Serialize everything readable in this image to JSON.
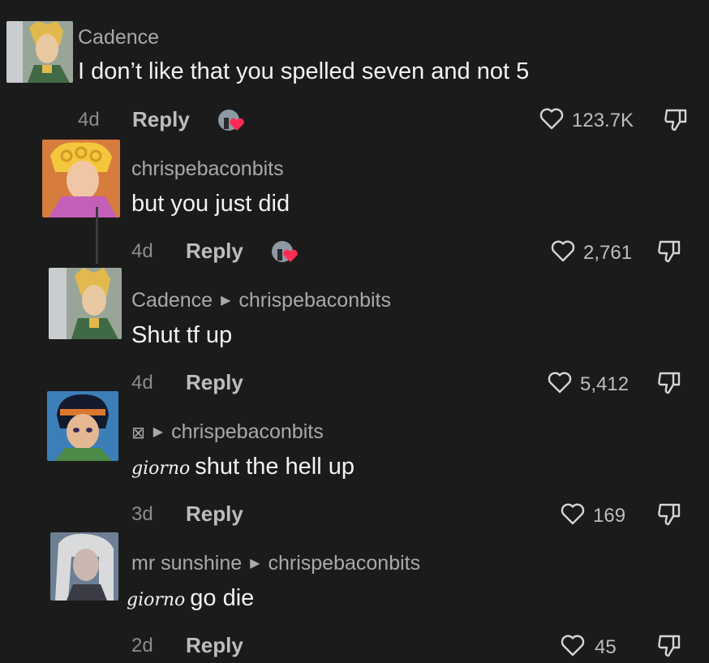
{
  "comments": [
    {
      "username": "Cadence",
      "reply_to": "",
      "text": "I don’t like that you spelled seven and not 5",
      "handwritten_prefix": "",
      "age": "4d",
      "reply_label": "Reply",
      "likes": "123.7K",
      "creator_liked": true
    },
    {
      "username": "chrispebaconbits",
      "reply_to": "",
      "text": "but you just did",
      "handwritten_prefix": "",
      "age": "4d",
      "reply_label": "Reply",
      "likes": "2,761",
      "creator_liked": true
    },
    {
      "username": "Cadence",
      "reply_to": "chrispebaconbits",
      "text": "Shut tf up",
      "handwritten_prefix": "",
      "age": "4d",
      "reply_label": "Reply",
      "likes": "5,412",
      "creator_liked": false
    },
    {
      "username": "⊠",
      "reply_to": "chrispebaconbits",
      "text": "shut the hell up",
      "handwritten_prefix": "giorno",
      "age": "3d",
      "reply_label": "Reply",
      "likes": "169",
      "creator_liked": false
    },
    {
      "username": "mr sunshine",
      "reply_to": "chrispebaconbits",
      "text": "go die",
      "handwritten_prefix": "giorno",
      "age": "2d",
      "reply_label": "Reply",
      "likes": "45",
      "creator_liked": false
    }
  ],
  "icons": {
    "like": "heart-outline-icon",
    "dislike": "thumbs-down-icon",
    "creator_like": "creator-liked-badge"
  },
  "colors": {
    "background": "#1b1b1b",
    "creator_heart": "#fe2c55"
  }
}
